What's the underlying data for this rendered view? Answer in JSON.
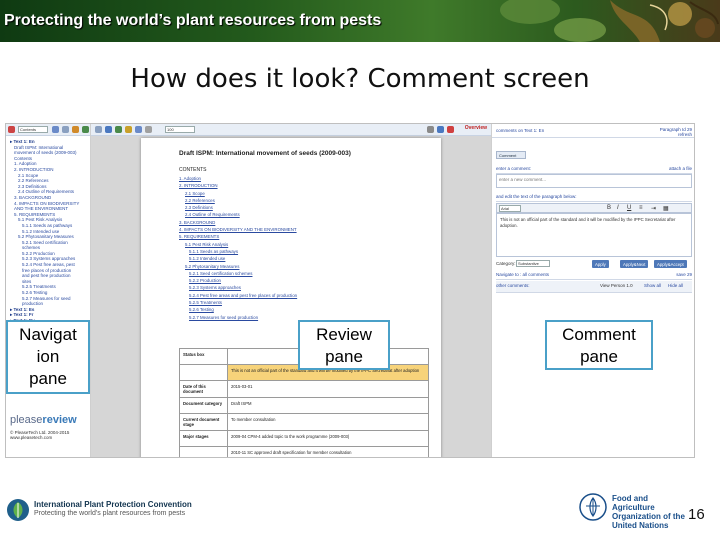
{
  "banner": {
    "title": "Protecting the world’s plant resources from pests"
  },
  "slide": {
    "title": "How does it look? Comment screen",
    "page_number": "16"
  },
  "screenshot": {
    "nav": {
      "dropdown": "Contents",
      "items": [
        {
          "label": "Text 1: En",
          "level": 0
        },
        {
          "label": "Draft ISPM: International",
          "level": 1
        },
        {
          "label": "movement of seeds (2009-003)",
          "level": 1
        },
        {
          "label": "Contents",
          "level": 1
        },
        {
          "label": "1. Adoption",
          "level": 1
        },
        {
          "label": "2. INTRODUCTION",
          "level": 1
        },
        {
          "label": "2.1 Scope",
          "level": 2
        },
        {
          "label": "2.2 References",
          "level": 2
        },
        {
          "label": "2.3 Definitions",
          "level": 2
        },
        {
          "label": "2.4 Outline of Requirements",
          "level": 2
        },
        {
          "label": "3. BACKGROUND",
          "level": 1
        },
        {
          "label": "4. IMPACTS ON BIODIVERSITY",
          "level": 1
        },
        {
          "label": "AND THE ENVIRONMENT",
          "level": 1
        },
        {
          "label": "5. REQUIREMENTS",
          "level": 1
        },
        {
          "label": "5.1 Pest Risk Analysis",
          "level": 2
        },
        {
          "label": "5.1.1 Seeds as pathways",
          "level": 3
        },
        {
          "label": "5.1.2 Intended use",
          "level": 3
        },
        {
          "label": "5.2 Phytosanitary Measures",
          "level": 2
        },
        {
          "label": "5.2.1 Seed certification",
          "level": 3
        },
        {
          "label": "schemes",
          "level": 3
        },
        {
          "label": "5.2.2 Production",
          "level": 3
        },
        {
          "label": "5.2.3 Systems approaches",
          "level": 3
        },
        {
          "label": "5.2.4 Pest free areas, pest",
          "level": 3
        },
        {
          "label": "free places of production",
          "level": 3
        },
        {
          "label": "and pest free production",
          "level": 3
        },
        {
          "label": "sites",
          "level": 3
        },
        {
          "label": "5.2.5 Treatments",
          "level": 3
        },
        {
          "label": "5.2.6 Testing",
          "level": 3
        },
        {
          "label": "5.2.7 Measures for seed",
          "level": 3
        },
        {
          "label": "production",
          "level": 3
        },
        {
          "label": "Text 1: Es",
          "level": 0
        },
        {
          "label": "Text 1: Fr",
          "level": 0
        },
        {
          "label": "Text 1: Ru",
          "level": 0
        }
      ],
      "logo_text_1": "please",
      "logo_text_2": "review",
      "copyright": "© PleaseTech Ltd. 2004-2015",
      "copyright_sub": "www.pleasetech.com"
    },
    "review": {
      "zoom": "100",
      "brand_label": "Overview",
      "doc_title": "Draft ISPM: International movement of seeds (2009-003)",
      "toc_heading": "CONTENTS",
      "toc": [
        {
          "label": "1. Adoption",
          "level": 1
        },
        {
          "label": "2. INTRODUCTION",
          "level": 1
        },
        {
          "label": "2.1 Scope",
          "level": 2
        },
        {
          "label": "2.2 References",
          "level": 2
        },
        {
          "label": "2.3 Definitions",
          "level": 2
        },
        {
          "label": "2.4 Outline of Requirements",
          "level": 2
        },
        {
          "label": "3. BACKGROUND",
          "level": 1
        },
        {
          "label": "4. IMPACTS ON BIODIVERSITY AND THE ENVIRONMENT",
          "level": 1
        },
        {
          "label": "5. REQUIREMENTS",
          "level": 1
        },
        {
          "label": "5.1 Pest Risk Analysis",
          "level": 2
        },
        {
          "label": "5.1.1 Seeds as pathways",
          "level": 3
        },
        {
          "label": "5.1.2 Intended use",
          "level": 3
        },
        {
          "label": "5.2 Phytosanitary Measures",
          "level": 2
        },
        {
          "label": "5.2.1 Seed certification schemes",
          "level": 3
        },
        {
          "label": "5.2.2 Production",
          "level": 3
        },
        {
          "label": "5.2.3 Systems approaches",
          "level": 3
        },
        {
          "label": "5.2.4 Pest free areas and pest free places of production",
          "level": 3
        },
        {
          "label": "5.2.5 Treatments",
          "level": 3
        },
        {
          "label": "5.2.6 Testing",
          "level": 3
        },
        {
          "label": "5.2.7 Measures for seed production",
          "level": 3
        }
      ],
      "table": [
        {
          "key": "Status box",
          "value": ""
        },
        {
          "key": "",
          "value": "This is not an official part of the standard and it will be modified by the IPPC Secretariat after adoption"
        },
        {
          "key": "Date of this document",
          "value": "2015-03-01"
        },
        {
          "key": "Document category",
          "value": "Draft ISPM"
        },
        {
          "key": "Current document stage",
          "value": "To member consultation"
        },
        {
          "key": "Major stages",
          "value": "2009-04 CPM-4 added topic to the work programme (2009-003)"
        },
        {
          "key": "",
          "value": "2010-11 SC approved draft specification for member consultation"
        }
      ]
    },
    "comment": {
      "title": "comments on Text 1: En",
      "paragraph_label": "Paragraph Id 29",
      "refresh_label": "refresh",
      "subject_button": "Comment",
      "enter_label": "enter a comment:",
      "attach_label": "attach a file",
      "placeholder": "enter a new comment...",
      "edit_label": "and edit the text of the paragraph below:",
      "font_select": "Arial",
      "edit_text": "This is not an official part of the standard and it will be modified by the IPPC Secretariat after adoption.",
      "category_label": "Category:",
      "category_value": "Substantive",
      "apply_button": "Apply",
      "apply_next_button": "Apply&Next",
      "apply_accept_button": "Apply&Accept",
      "nav_label": "Navigate to : all comments",
      "save_label": "save 29",
      "other_comments": "other comments:",
      "view_label": "View Person 1.0",
      "show_all": "Show all",
      "hide_all": "Hide all"
    }
  },
  "callouts": {
    "navigation": "Navigat\nion\npane",
    "review": "Review\npane",
    "comment": "Comment\npane"
  },
  "footer": {
    "ippc_name": "International Plant Protection Convention",
    "ippc_tagline": "Protecting the world's plant resources from pests",
    "fao_name": "Food and Agriculture Organization of the United Nations"
  }
}
